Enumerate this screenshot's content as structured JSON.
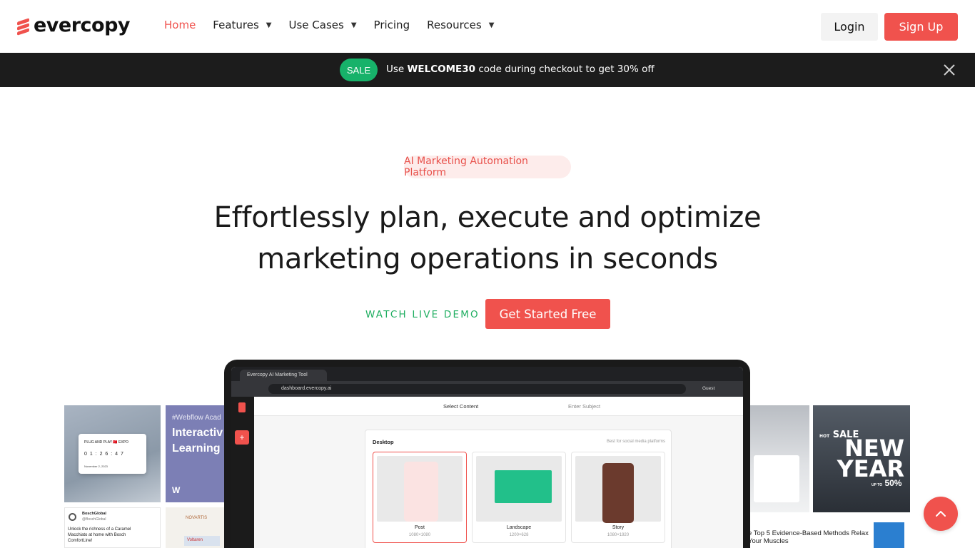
{
  "brand": {
    "name": "evercopy",
    "accent": "#f0524d"
  },
  "nav": {
    "items": [
      {
        "label": "Home",
        "active": true,
        "dropdown": false
      },
      {
        "label": "Features",
        "active": false,
        "dropdown": true
      },
      {
        "label": "Use Cases",
        "active": false,
        "dropdown": true
      },
      {
        "label": "Pricing",
        "active": false,
        "dropdown": false
      },
      {
        "label": "Resources",
        "active": false,
        "dropdown": true
      }
    ],
    "login_label": "Login",
    "signup_label": "Sign Up"
  },
  "promo": {
    "badge": "SALE",
    "text_before": "Use ",
    "code": "WELCOME30",
    "text_after": " code during checkout to get 30% off",
    "close_icon": "close-icon"
  },
  "hero": {
    "pill": "AI Marketing Automation Platform",
    "title_line1": "Effortlessly plan, execute and optimize",
    "title_line2": "marketing operations in seconds",
    "watch_demo": "WATCH LIVE DEMO",
    "cta": "Get Started Free"
  },
  "showcase": {
    "left_tiles": {
      "expo_title": "PLUG AND PLAY 🇹🇷 EXPO",
      "countdown": "0 1 : 2 6 : 4 7",
      "date": "November 2, 2023",
      "webflow_tag": "#Webflow Acad",
      "webflow_title": "Interactiv Learning",
      "bosch_name": "BoschGlobal",
      "bosch_handle": "@BoschGlobal",
      "bosch_text": "Unlock the richness of a Caramel Macchiato at home with Bosch ComfortLine!",
      "novartis": "NOVARTIS",
      "voltaren": "Voltaren"
    },
    "browser": {
      "tab_title": "Evercopy AI Marketing Tool",
      "url": "dashboard.evercopy.ai",
      "profile": "Guest"
    },
    "app": {
      "step1": "Select Content",
      "step2": "Enter Subject",
      "panel_title": "Desktop",
      "panel_hint": "Best for social media platforms",
      "cards": [
        {
          "label": "Post",
          "size": "1080×1080",
          "selected": true
        },
        {
          "label": "Landscape",
          "size": "1200×628",
          "selected": false
        },
        {
          "label": "Story",
          "size": "1080×1920",
          "selected": false
        }
      ]
    },
    "right_tiles": {
      "sale_hot": "HOT",
      "sale_word": "SALE",
      "new_year": "NEW YEAR",
      "up_to": "UP TO",
      "percent": "50%",
      "article": "e Top 5 Evidence-Based Methods Relax Your Muscles"
    }
  },
  "scroll_top_icon": "chevron-up-icon"
}
